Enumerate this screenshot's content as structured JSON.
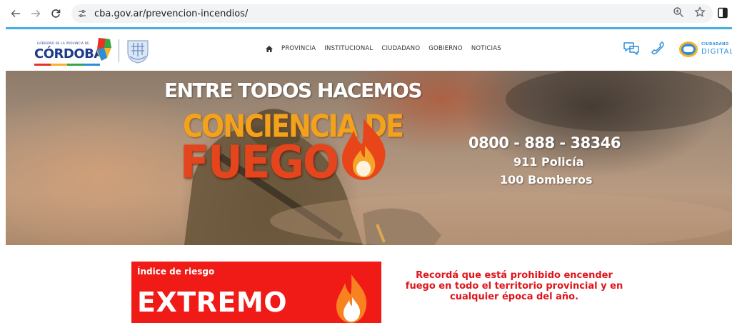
{
  "browser": {
    "url": "cba.gov.ar/prevencion-incendios/"
  },
  "header": {
    "logo_text": "CÓRDOBA",
    "logo_subtext": "GOBIERNO DE LA PROVINCIA DE",
    "nav": [
      "PROVINCIA",
      "INSTITUCIONAL",
      "CIUDADANO",
      "GOBIERNO",
      "NOTICIAS"
    ],
    "cd_small": "CIUDADANO",
    "cd_big": "DIGITAL"
  },
  "hero": {
    "title": "ENTRE TODOS HACEMOS",
    "line1": "CONCIENCIA DE",
    "line2": "FUEGO",
    "phone": "0800 - 888 - 38346",
    "police": "911 Policía",
    "firefighters": "100 Bomberos"
  },
  "risk": {
    "label": "Índice de riesgo",
    "level": "EXTREMO"
  },
  "warning": {
    "text": "Recordá que está prohibido encender fuego en todo el territorio provincial y en cualquier época del año."
  },
  "colors": {
    "accent_line": "#45b0e0",
    "brand_blue": "#1d3b8c",
    "risk_red": "#f01a17",
    "warning_red": "#e0141b",
    "hero_orange": "#f2a31b"
  },
  "icons": {
    "back": "arrow-left-icon",
    "forward": "arrow-right-icon",
    "reload": "reload-icon",
    "site_info": "tune-icon",
    "zoom": "zoom-icon",
    "bookmark": "star-icon",
    "side_panel": "side-panel-icon",
    "home": "home-icon",
    "chat": "chat-icon",
    "phone": "phone-icon",
    "flame": "flame-icon"
  }
}
